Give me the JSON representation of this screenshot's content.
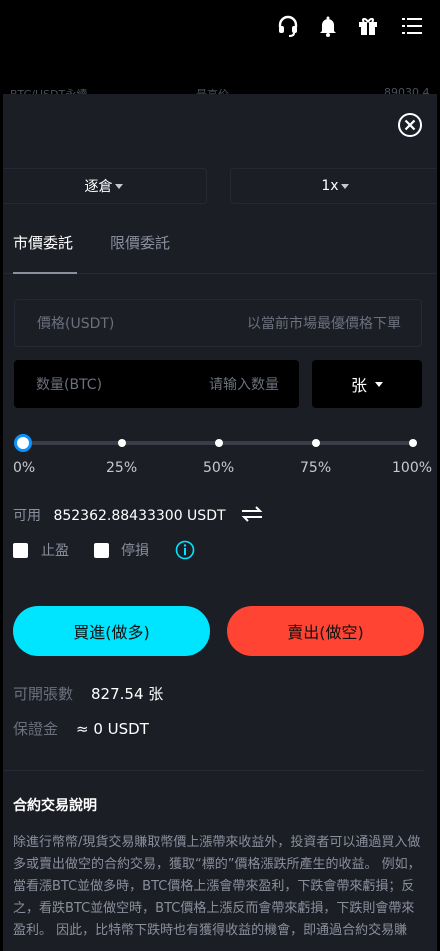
{
  "peek_row": {
    "left": "BTC/USDT永續",
    "middle": "最高价",
    "right": "89030.4"
  },
  "close_label": "關閉",
  "margin_mode": {
    "label": "逐倉"
  },
  "leverage": {
    "label": "1x"
  },
  "tabs": [
    {
      "label": "市價委託",
      "active": true
    },
    {
      "label": "限價委託",
      "active": false
    }
  ],
  "price_field": {
    "label": "價格(USDT)",
    "placeholder": "以當前市場最優價格下單"
  },
  "qty_field": {
    "label": "数量(BTC)",
    "placeholder": "请输入数量"
  },
  "unit_select": {
    "label": "张"
  },
  "slider": {
    "value": 0,
    "marks": [
      "0%",
      "25%",
      "50%",
      "75%",
      "100%"
    ]
  },
  "available": {
    "label": "可用",
    "value": "852362.88433300 USDT"
  },
  "options": {
    "take_profit": "止盈",
    "stop_loss": "停損"
  },
  "buttons": {
    "buy": "買進(做多)",
    "sell": "賣出(做空)"
  },
  "openable": {
    "label": "可開張數",
    "value": "827.54 张"
  },
  "margin": {
    "label": "保證金",
    "value": "≈ 0 USDT"
  },
  "description": {
    "title": "合約交易說明",
    "body": "除進行幣幣/現貨交易賺取幣價上漲帶來收益外，投資者可以通過買入做多或賣出做空的合約交易，獲取“標的”價格漲跌所產生的收益。 例如，當看漲BTC並做多時，BTC價格上漲會帶來盈利，下跌會帶來虧損；反之，看跌BTC並做空時，BTC價格上漲反而會帶來虧損，下跌則會帶來盈利。 因此，比特幣下跌時也有獲得收益的機會，即通過合約交易賺"
  },
  "colors": {
    "accent_buy": "#00e5ff",
    "accent_sell": "#ff4433",
    "info_icon": "#00e5ff",
    "slider_thumb": "#0b93ff"
  }
}
